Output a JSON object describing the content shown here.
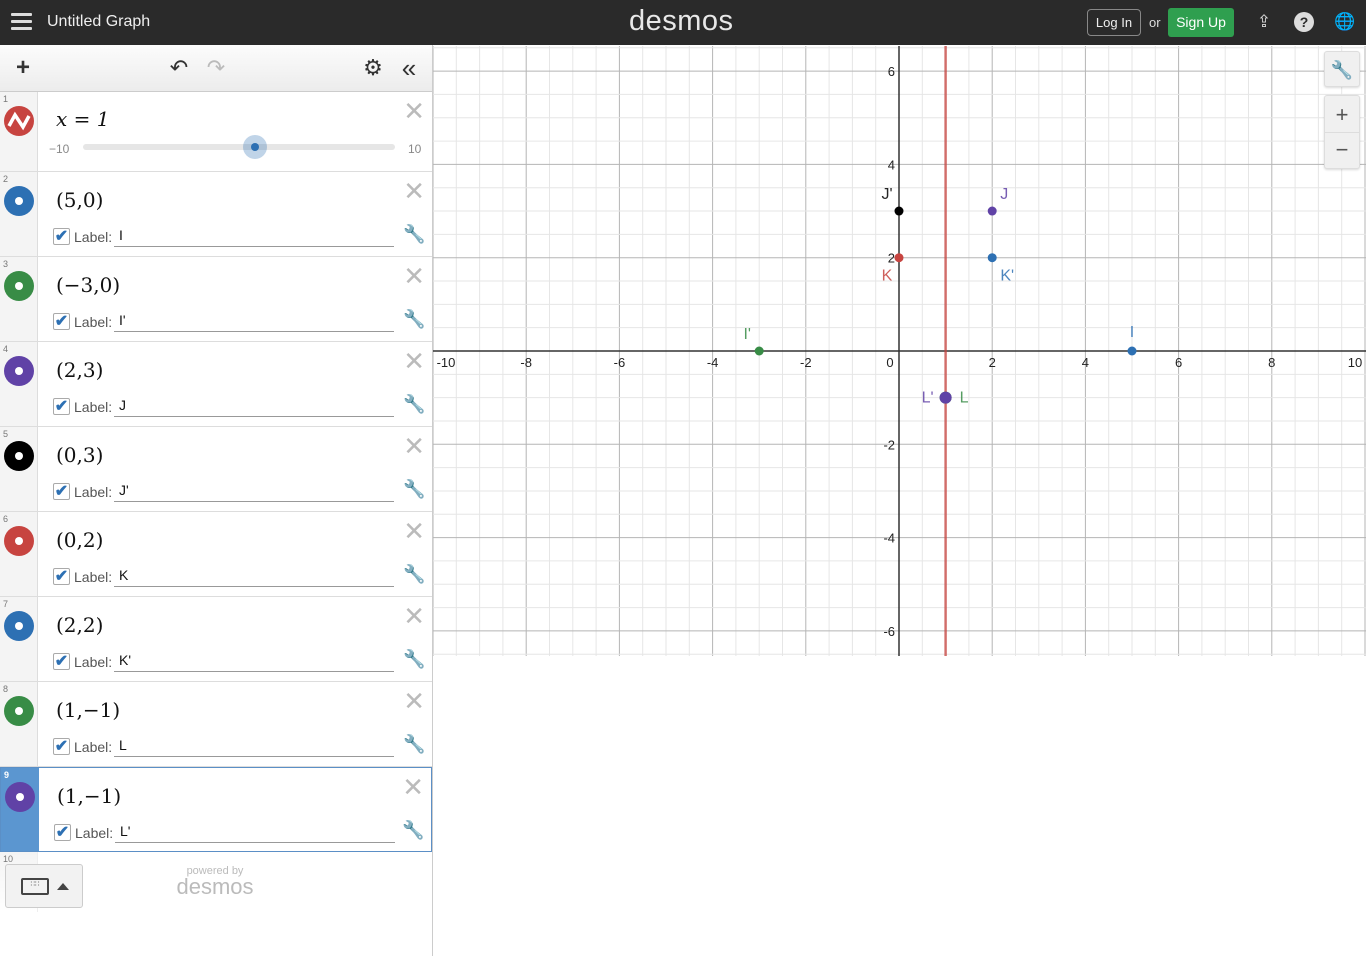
{
  "header": {
    "title": "Untitled Graph",
    "logo": "desmos",
    "login": "Log In",
    "or": "or",
    "signup": "Sign Up",
    "icons": [
      "share-icon",
      "help-icon",
      "globe-icon"
    ]
  },
  "toolbar": {
    "icons": [
      "add-icon",
      "undo-icon",
      "redo-icon",
      "settings-icon",
      "collapse-icon"
    ]
  },
  "expressions": [
    {
      "num": "1",
      "latex": "x = 1",
      "color": "#c74440",
      "type": "line",
      "slider": {
        "min": "−10",
        "max": "10",
        "value": 1
      }
    },
    {
      "num": "2",
      "latex": "(5,0)",
      "color": "#2d70b3",
      "label_text": "Label:",
      "label": "I",
      "checked": true
    },
    {
      "num": "3",
      "latex": "(−3,0)",
      "color": "#388c46",
      "label_text": "Label:",
      "label": "I'",
      "checked": true
    },
    {
      "num": "4",
      "latex": "(2,3)",
      "color": "#6042a6",
      "label_text": "Label:",
      "label": "J",
      "checked": true
    },
    {
      "num": "5",
      "latex": "(0,3)",
      "color": "#000000",
      "label_text": "Label:",
      "label": "J'",
      "checked": true
    },
    {
      "num": "6",
      "latex": "(0,2)",
      "color": "#c74440",
      "label_text": "Label:",
      "label": "K",
      "checked": true
    },
    {
      "num": "7",
      "latex": "(2,2)",
      "color": "#2d70b3",
      "label_text": "Label:",
      "label": "K'",
      "checked": true
    },
    {
      "num": "8",
      "latex": "(1,−1)",
      "color": "#388c46",
      "label_text": "Label:",
      "label": "L",
      "checked": true
    },
    {
      "num": "9",
      "latex": "(1,−1)",
      "color": "#6042a6",
      "label_text": "Label:",
      "label": "L'",
      "checked": true,
      "selected": true
    }
  ],
  "empty_row_num": "10",
  "footer": {
    "powered_by": "powered by",
    "brand": "desmos"
  },
  "chart_data": {
    "type": "scatter",
    "xlim": [
      -10,
      10
    ],
    "ylim": [
      -6.5,
      6.5
    ],
    "grid": true,
    "x_ticks": [
      "-10",
      "-8",
      "-6",
      "-4",
      "-2",
      "0",
      "2",
      "4",
      "6",
      "8",
      "10"
    ],
    "y_ticks": [
      "6",
      "4",
      "2",
      "-2",
      "-4",
      "-6"
    ],
    "vertical_line": {
      "x": 1,
      "color": "#c74440"
    },
    "points": [
      {
        "x": 5,
        "y": 0,
        "label": "I",
        "color": "#2d70b3",
        "pos": "above"
      },
      {
        "x": -3,
        "y": 0,
        "label": "I'",
        "color": "#388c46",
        "pos": "aboveleft"
      },
      {
        "x": 2,
        "y": 3,
        "label": "J",
        "color": "#6042a6",
        "pos": "aboveright"
      },
      {
        "x": 0,
        "y": 3,
        "label": "J'",
        "color": "#000000",
        "pos": "aboveleft"
      },
      {
        "x": 0,
        "y": 2,
        "label": "K",
        "color": "#c74440",
        "pos": "belowleft"
      },
      {
        "x": 2,
        "y": 2,
        "label": "K'",
        "color": "#2d70b3",
        "pos": "belowright"
      },
      {
        "x": 1,
        "y": -1,
        "label": "L",
        "color": "#388c46",
        "pos": "right"
      },
      {
        "x": 1,
        "y": -1,
        "label": "L'",
        "color": "#6042a6",
        "pos": "left"
      }
    ]
  }
}
